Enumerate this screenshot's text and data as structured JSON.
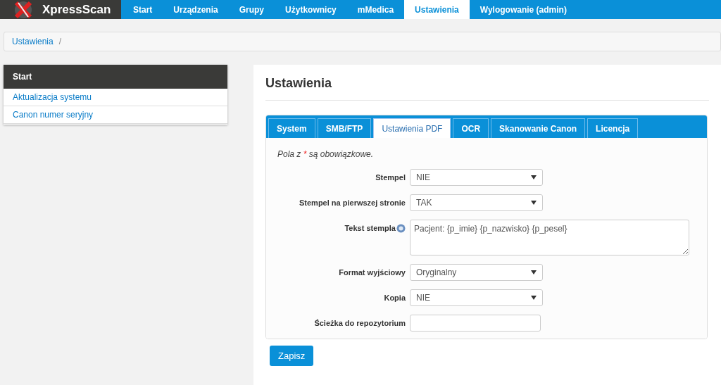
{
  "brand": "XpressScan",
  "nav": [
    {
      "label": "Start",
      "selected": false
    },
    {
      "label": "Urządzenia",
      "selected": false
    },
    {
      "label": "Grupy",
      "selected": false
    },
    {
      "label": "Użytkownicy",
      "selected": false
    },
    {
      "label": "mMedica",
      "selected": false
    },
    {
      "label": "Ustawienia",
      "selected": true
    },
    {
      "label": "Wylogowanie (admin)",
      "selected": false
    }
  ],
  "breadcrumb": {
    "items": [
      "Ustawienia"
    ],
    "separator": "/"
  },
  "sidebar": {
    "title": "Start",
    "items": [
      "Aktualizacja systemu",
      "Canon numer seryjny"
    ]
  },
  "page_title": "Ustawienia",
  "tabs": [
    {
      "label": "System",
      "selected": false
    },
    {
      "label": "SMB/FTP",
      "selected": false
    },
    {
      "label": "Ustawienia PDF",
      "selected": true
    },
    {
      "label": "OCR",
      "selected": false
    },
    {
      "label": "Skanowanie Canon",
      "selected": false
    },
    {
      "label": "Licencja",
      "selected": false
    }
  ],
  "required_note": {
    "prefix": "Pola z ",
    "mark": "*",
    "suffix": " są obowiązkowe."
  },
  "fields": [
    {
      "kind": "select",
      "label": "Stempel",
      "value": "NIE"
    },
    {
      "kind": "select",
      "label": "Stempel na pierwszej stronie",
      "value": "TAK"
    },
    {
      "kind": "textarea",
      "label": "Tekst stempla",
      "help": true,
      "value": "Pacjent: {p_imie} {p_nazwisko} {p_pesel}"
    },
    {
      "kind": "select",
      "label": "Format wyjściowy",
      "value": "Oryginalny"
    },
    {
      "kind": "select",
      "label": "Kopia",
      "value": "NIE"
    },
    {
      "kind": "input",
      "label": "Ścieżka do repozytorium"
    }
  ],
  "save_button": "Zapisz"
}
